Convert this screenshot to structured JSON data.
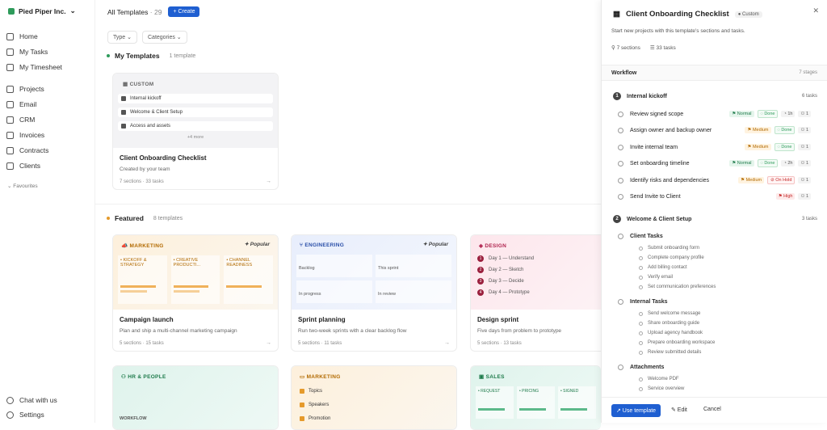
{
  "org": {
    "name": "Pied Piper Inc."
  },
  "nav": [
    {
      "label": "Home",
      "icon": "home-icon"
    },
    {
      "label": "My Tasks",
      "icon": "tasks-icon"
    },
    {
      "label": "My Timesheet",
      "icon": "timesheet-icon"
    },
    {
      "label": "Projects",
      "icon": "projects-icon"
    },
    {
      "label": "Email",
      "icon": "mail-icon"
    },
    {
      "label": "CRM",
      "icon": "crm-icon"
    },
    {
      "label": "Invoices",
      "icon": "invoice-icon"
    },
    {
      "label": "Contracts",
      "icon": "contract-icon"
    },
    {
      "label": "Clients",
      "icon": "clients-icon"
    }
  ],
  "favourites": "Favourites",
  "bottom_nav": [
    {
      "label": "Chat with us"
    },
    {
      "label": "Settings"
    }
  ],
  "header": {
    "title": "All Templates",
    "count": "· 29",
    "create": "+ Create"
  },
  "filters": {
    "type": "Type",
    "categories": "Categories"
  },
  "my_templates": {
    "title": "My Templates",
    "count": "1 template",
    "card": {
      "tag": "CUSTOM",
      "items": [
        "Internal kickoff",
        "Welcome & Client Setup",
        "Access and assets"
      ],
      "more": "+4 more",
      "title": "Client Onboarding Checklist",
      "desc": "Created by your team",
      "meta": "7 sections · 33 tasks"
    }
  },
  "featured": {
    "title": "Featured",
    "count": "8 templates",
    "cards": [
      {
        "tag": "MARKETING",
        "popular": "Popular",
        "cols": [
          "• KICKOFF & STRATEGY",
          "• CREATIVE PRODUCTI...",
          "• CHANNEL READINESS"
        ],
        "title": "Campaign launch",
        "desc": "Plan and ship a multi-channel marketing campaign",
        "meta": "5 sections · 15 tasks"
      },
      {
        "tag": "ENGINEERING",
        "popular": "Popular",
        "cells": [
          "Backlog",
          "This sprint",
          "In progress",
          "In review"
        ],
        "title": "Sprint planning",
        "desc": "Run two-week sprints with a clear backlog flow",
        "meta": "5 sections · 11 tasks"
      },
      {
        "tag": "DESIGN",
        "days": [
          "Day 1 — Understand",
          "Day 2 — Sketch",
          "Day 3 — Decide",
          "Day 4 — Prototype"
        ],
        "title": "Design sprint",
        "desc": "Five days from problem to prototype",
        "meta": "5 sections · 13 tasks"
      }
    ],
    "row2": [
      {
        "tag": "HR & PEOPLE",
        "sub": "WORKFLOW"
      },
      {
        "tag": "MARKETING",
        "items": [
          "Topics",
          "Speakers",
          "Promotion"
        ]
      },
      {
        "tag": "SALES",
        "cols": [
          "• REQUEST",
          "• PRICING",
          "• SIGNED"
        ]
      }
    ]
  },
  "panel": {
    "title": "Client Onboarding Checklist",
    "badge": "Custom",
    "desc": "Start new projects with this template's sections and tasks.",
    "sections": "7 sections",
    "tasks": "33 tasks",
    "workflow": "Workflow",
    "stages": "7 stages",
    "sec1": {
      "num": "1",
      "title": "Internal kickoff",
      "count": "6 tasks"
    },
    "sec1_tasks": [
      {
        "name": "Review signed scope",
        "prio": "Normal",
        "status": "Done",
        "est": "1h",
        "ppl": "1"
      },
      {
        "name": "Assign owner and backup owner",
        "prio": "Medium",
        "status": "Done",
        "est": "",
        "ppl": "1"
      },
      {
        "name": "Invite internal team",
        "prio": "Medium",
        "status": "Done",
        "est": "",
        "ppl": "1"
      },
      {
        "name": "Set onboarding timeline",
        "prio": "Normal",
        "status": "Done",
        "est": "2h",
        "ppl": "1"
      },
      {
        "name": "Identify risks and dependencies",
        "prio": "Medium",
        "status": "On Hold",
        "est": "",
        "ppl": "1"
      },
      {
        "name": "Send Invite to Client",
        "prio": "High",
        "status": "",
        "est": "",
        "ppl": "1"
      }
    ],
    "sec2": {
      "num": "2",
      "title": "Welcome & Client Setup",
      "count": "3 tasks"
    },
    "groups": [
      {
        "title": "Client Tasks",
        "items": [
          "Submit onboarding form",
          "Complete company profile",
          "Add billing contact",
          "Verify email",
          "Set communication preferences"
        ]
      },
      {
        "title": "Internal Tasks",
        "items": [
          "Send welcome message",
          "Share onboarding guide",
          "Upload agency handbook",
          "Prepare onboarding workspace",
          "Review submitted details"
        ]
      },
      {
        "title": "Attachments",
        "items": [
          "Welcome PDF",
          "Service overview"
        ]
      }
    ],
    "use": "↗ Use template",
    "edit": "✎ Edit",
    "cancel": "Cancel"
  }
}
